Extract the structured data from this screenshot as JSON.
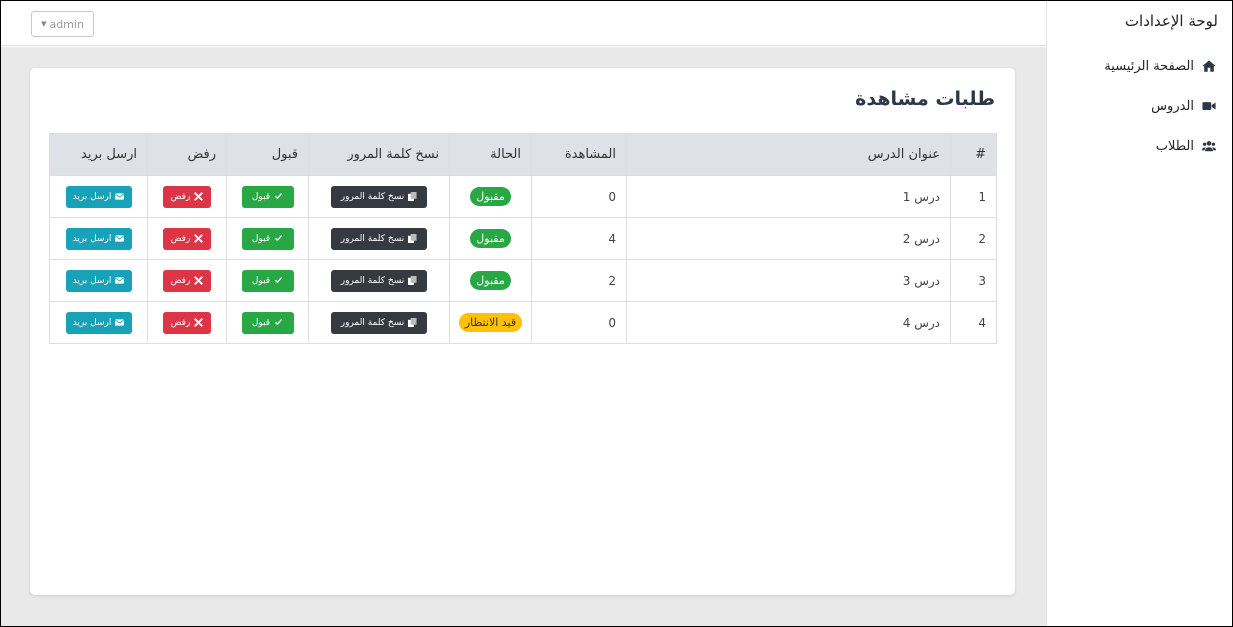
{
  "header": {
    "user_label": "admin"
  },
  "sidebar": {
    "brand": "لوحة الإعدادات",
    "items": [
      {
        "label": "الصفحة الرئيسية",
        "icon": "home-icon"
      },
      {
        "label": "الدروس",
        "icon": "video-icon"
      },
      {
        "label": "الطلاب",
        "icon": "users-icon"
      }
    ]
  },
  "main": {
    "title": "طلبات مشاهدة",
    "table": {
      "headers": [
        "#",
        "عنوان الدرس",
        "المشاهدة",
        "الحالة",
        "نسخ كلمة المرور",
        "قبول",
        "رفض",
        "ارسل بريد"
      ],
      "rows": [
        {
          "num": "1",
          "title": "درس 1",
          "views": "0",
          "status": "مقبول",
          "status_type": "approved",
          "copy": "نسخ كلمة المرور",
          "accept": "قبول",
          "reject": "رفض",
          "email": "ارسل بريد"
        },
        {
          "num": "2",
          "title": "درس 2",
          "views": "4",
          "status": "مقبول",
          "status_type": "approved",
          "copy": "نسخ كلمة المرور",
          "accept": "قبول",
          "reject": "رفض",
          "email": "ارسل بريد"
        },
        {
          "num": "3",
          "title": "درس 3",
          "views": "2",
          "status": "مقبول",
          "status_type": "approved",
          "copy": "نسخ كلمة المرور",
          "accept": "قبول",
          "reject": "رفض",
          "email": "ارسل بريد"
        },
        {
          "num": "4",
          "title": "درس 4",
          "views": "0",
          "status": "قيد الانتظار",
          "status_type": "pending",
          "copy": "نسخ كلمة المرور",
          "accept": "قبول",
          "reject": "رفض",
          "email": "ارسل بريد"
        }
      ]
    }
  },
  "colors": {
    "approved": "#28a745",
    "pending": "#ffc107",
    "copy_button": "#343a40",
    "accept_button": "#28a745",
    "reject_button": "#dc3545",
    "email_button": "#17a2b8"
  }
}
